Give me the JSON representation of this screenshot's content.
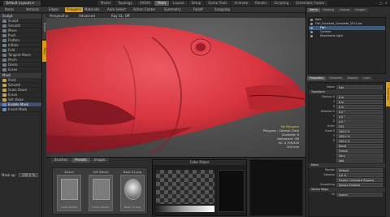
{
  "topbar": {
    "layout_label": "Default Layouts ▾",
    "tabs": [
      "Model",
      "Topology",
      "UVEdit",
      "Paint",
      "Layout",
      "Setup",
      "Game Tools",
      "Animate",
      "Render",
      "Scripting",
      "Schematic Fusion"
    ],
    "active_tab": "Paint"
  },
  "toolbar": {
    "buttons": [
      "Items",
      "Vertices",
      "Edges",
      "Polygons",
      "Materials",
      "Auto Select",
      "Action Center",
      "Symmetry",
      "Falloff",
      "Snapping"
    ],
    "active": "Polygons"
  },
  "left_panel": {
    "vtabs": [
      "Sculpt",
      "Paint"
    ],
    "sections": [
      {
        "title": "Sculpt",
        "items": [
          "Sculpt",
          "Smooth",
          "Move",
          "Push",
          "Flatten",
          "Inflate",
          "Fold",
          "Tangent Move",
          "Pinch",
          "Dents",
          "Erase"
        ]
      },
      {
        "title": "Mask",
        "items": [
          "Paint",
          "Smooth",
          "Scale Down",
          "Erase",
          "Set Value",
          "Enable Mask",
          "Invert Mask"
        ]
      }
    ],
    "mask_label": "Mask op:",
    "mask_value": "100.0 %"
  },
  "viewport": {
    "header": [
      "Perspective",
      "Advanced",
      "Ray GL: Off"
    ],
    "stats": {
      "selection": "No Polygons",
      "polygons": "Polygons : Catmull-Clark",
      "channels": "Channels: 6",
      "deformers": "Deformers: ON",
      "gl": "GL: 4,706,816",
      "dist": "200 mm"
    }
  },
  "dock": {
    "tabs": [
      "Brushes",
      "Presets",
      "Images"
    ],
    "active_tab": "Presets",
    "thumbs": [
      {
        "title": "Stencil",
        "caption": "(none active)"
      },
      {
        "title": "SnP Stencil",
        "caption": "(none active)"
      },
      {
        "title": "Basic 01.png",
        "caption": "Basic 01.png"
      }
    ],
    "color_picker_title": "Color Picker"
  },
  "items_panel": {
    "tabs": [
      "Items",
      "Shading",
      "Groups",
      "Images"
    ],
    "active_tab": "Items",
    "rows": [
      {
        "name": "Item",
        "selected": false
      },
      {
        "name": "Fish_Sculpted_Complete_2011.lxo",
        "selected": false
      },
      {
        "name": "Fish",
        "selected": true
      },
      {
        "name": "Camera",
        "selected": false
      },
      {
        "name": "Directional Light",
        "selected": false
      }
    ]
  },
  "properties_panel": {
    "tabs": [
      "Properties",
      "Channels",
      "Display",
      "Lists"
    ],
    "active_tab": "Properties",
    "name_label": "Name",
    "name_value": "Fish",
    "sections": [
      {
        "title": "Transform",
        "rows": [
          {
            "k": "Position X",
            "v": "0 m"
          },
          {
            "k": "Y",
            "v": "0 m"
          },
          {
            "k": "Z",
            "v": "0 m"
          },
          {
            "k": "Rotation X",
            "v": "0.0 °"
          },
          {
            "k": "Y",
            "v": "0.0 °"
          },
          {
            "k": "Z",
            "v": "0.0 °"
          },
          {
            "k": "Order",
            "v": "XYZ"
          },
          {
            "k": "Scale X",
            "v": "100.0 %"
          },
          {
            "k": "Y",
            "v": "100.0 %"
          },
          {
            "k": "Z",
            "v": "100.0 %"
          },
          {
            "k": "",
            "v": "Reset"
          },
          {
            "k": "",
            "v": "Freeze"
          },
          {
            "k": "",
            "v": "Zero"
          },
          {
            "k": "",
            "v": "Add"
          }
        ]
      },
      {
        "title": "Mesh",
        "rows": [
          {
            "k": "Render",
            "v": "Default"
          },
          {
            "k": "Dissolve",
            "v": "0.0 %"
          },
          {
            "k": "",
            "v": "Enable Command Regions"
          },
          {
            "k": "Smoothing",
            "v": "Always Enabled"
          }
        ]
      },
      {
        "title": "Vertex Maps",
        "rows": [
          {
            "k": "UV",
            "v": "(none)"
          }
        ]
      }
    ],
    "side_label": "Properties"
  },
  "colors": {
    "accent": "#e0a31e",
    "fish_body": "#d9353f",
    "fish_shadow": "#8f1d28",
    "selection": "#3e5a7a"
  }
}
